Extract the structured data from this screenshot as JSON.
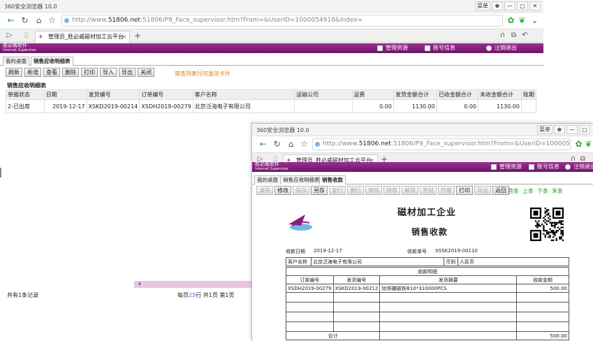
{
  "browser": {
    "title": "360安全浏览器 10.0",
    "menu_label": "菜单",
    "url": {
      "prefix": "http://www.",
      "host": "51806.net",
      "rest": ":51806/P9_Face_supervisor.htm?From=&UserID=1000054918&Index="
    },
    "tab_title": "管理员_胜必威磁材加工云平台",
    "tab_close": "×",
    "new_tab": "+"
  },
  "app": {
    "brand": "胜必威软件",
    "brand_sub": "Internet Supervisor",
    "header_links": [
      "管理资源",
      "账号信息",
      "注销退出"
    ],
    "accent": "#8a1f80"
  },
  "list_page": {
    "tabs": [
      "我的桌面",
      "销售应收明细表"
    ],
    "toolbar": [
      "刷新",
      "新增",
      "查看",
      "删除",
      "打印",
      "导入",
      "导出",
      "关闭"
    ],
    "hint": "双击列表行可显示卡片",
    "section_title": "销售应收明细表",
    "columns": [
      "单据状态",
      "日期",
      "发货编号",
      "订单编号",
      "客户名称",
      "运输公司",
      "运费",
      "发货金额合计",
      "已收金额合计",
      "未收金额合计",
      "账期"
    ],
    "rows": [
      [
        "2-已出库",
        "2019-12-17",
        "XSKD2019-00214",
        "XSDH2019-00279",
        "北京泛海电子有限公司",
        "",
        "0.00",
        "1130.00",
        "0.00",
        "1130.00",
        ""
      ]
    ],
    "record_count": "共有1条记录",
    "pager": {
      "per_page_prefix": "每页",
      "per_page_value": "25",
      "per_page_suffix": "行",
      "total_pages": "共1页",
      "current_page": "第1页"
    }
  },
  "receipt_page": {
    "tabs": [
      "我的桌面",
      "销售应收明细表",
      "销售收款"
    ],
    "toolbar": [
      {
        "label": "清除",
        "enabled": false
      },
      {
        "label": "修改",
        "enabled": true
      },
      {
        "label": "保存",
        "enabled": false
      },
      {
        "label": "另存",
        "enabled": true
      },
      {
        "label": "复行",
        "enabled": false
      },
      {
        "label": "删行",
        "enabled": false
      },
      {
        "label": "审核",
        "enabled": false
      },
      {
        "label": "销审",
        "enabled": false
      },
      {
        "label": "解锁",
        "enabled": false
      },
      {
        "label": "签财",
        "enabled": false
      },
      {
        "label": "作废",
        "enabled": false
      },
      {
        "label": "打印",
        "enabled": true
      },
      {
        "label": "导出",
        "enabled": false
      },
      {
        "label": "返回",
        "enabled": true
      }
    ],
    "nav_links": [
      "首条",
      "上条",
      "下条",
      "末条"
    ],
    "company": "磁材加工企业",
    "doc_title": "销售收款",
    "date_label": "收款日期",
    "date_value": "2019-12-17",
    "no_label": "收款单号",
    "no_value": "XSSK2019-00110",
    "customer_label": "客户名称",
    "customer_value": "北京泛海电子有限公司",
    "currency_label": "币别",
    "currency_value": "人民币",
    "detail_title": "收款明细",
    "detail_columns": [
      "订单编号",
      "发货编号",
      "发货摘要",
      "收款金额"
    ],
    "detail_rows": [
      [
        "XSDH2019-00279",
        "XSKD2019-00212",
        "钕铁硼磁铁Φ10*310000PCS",
        "500.00"
      ]
    ],
    "total_label": "合计",
    "total_value": "500.00"
  }
}
